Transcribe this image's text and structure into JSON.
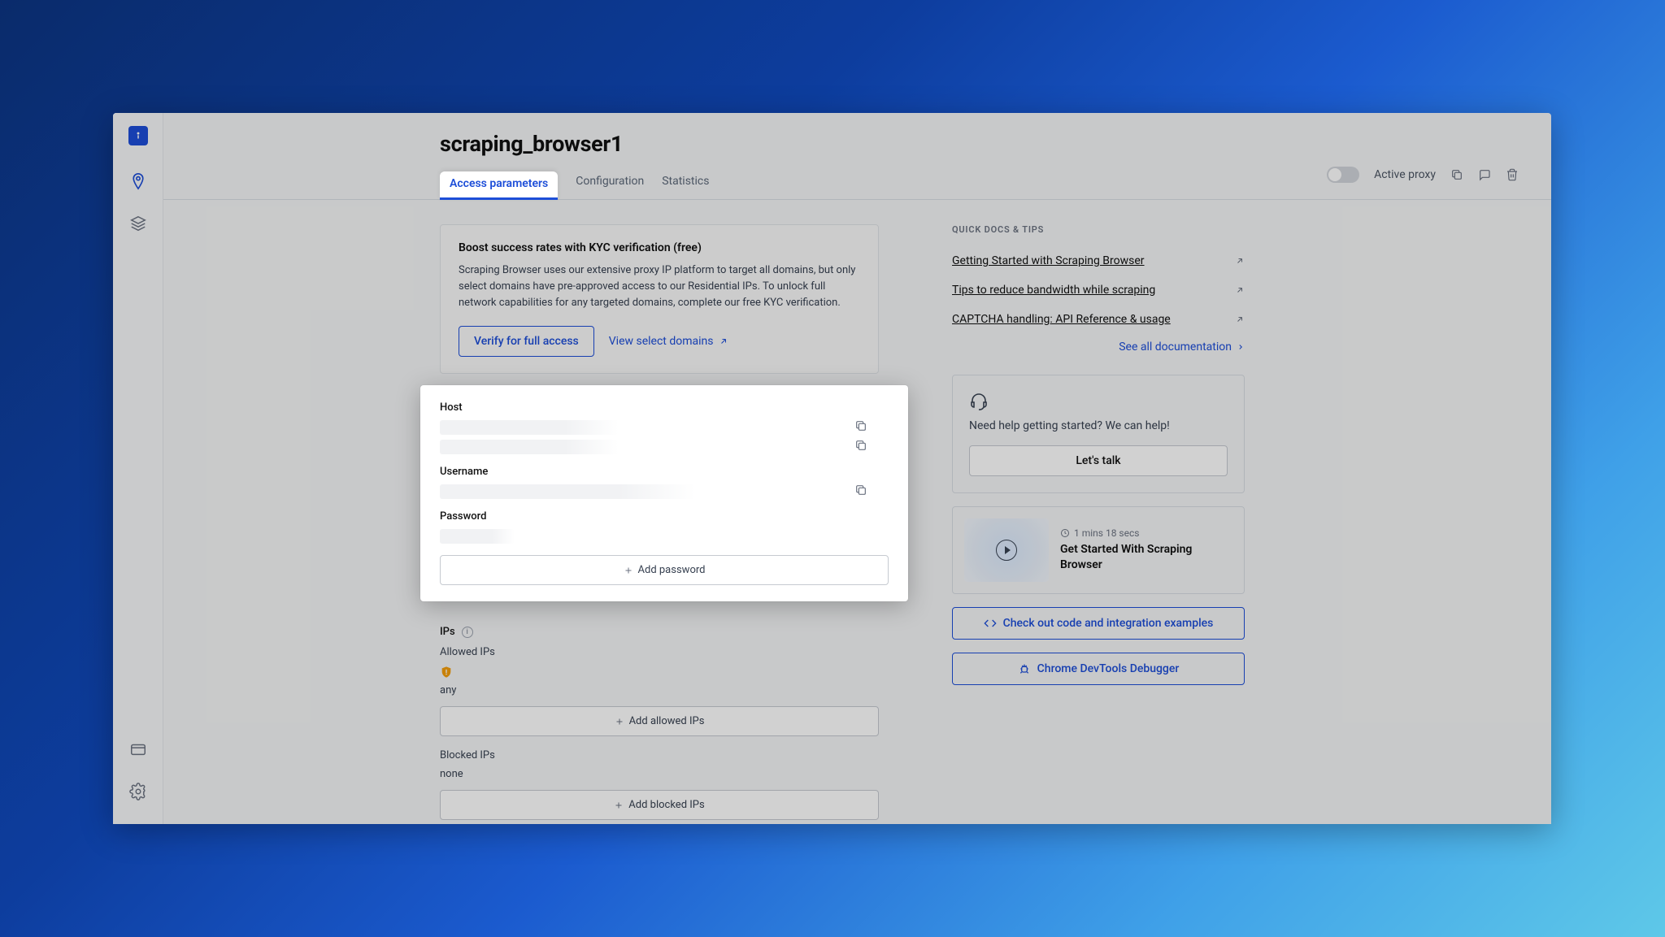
{
  "header": {
    "title": "scraping_browser1",
    "tabs": [
      {
        "label": "Access parameters",
        "active": true
      },
      {
        "label": "Configuration",
        "active": false
      },
      {
        "label": "Statistics",
        "active": false
      }
    ],
    "toggle_label": "Active proxy"
  },
  "kyc": {
    "title": "Boost success rates with KYC verification (free)",
    "body": "Scraping Browser uses our extensive proxy IP platform to target all domains, but only select domains have pre-approved access to our Residential IPs. To unlock full network capabilities for any targeted domains, complete our free KYC verification.",
    "verify_btn": "Verify for full access",
    "view_link": "View select domains"
  },
  "creds": {
    "host_label": "Host",
    "username_label": "Username",
    "password_label": "Password",
    "add_password_btn": "Add password"
  },
  "ips": {
    "section": "IPs",
    "allowed_label": "Allowed IPs",
    "allowed_value": "any",
    "add_allowed_btn": "Add allowed IPs",
    "blocked_label": "Blocked IPs",
    "blocked_value": "none",
    "add_blocked_btn": "Add blocked IPs"
  },
  "docs": {
    "heading": "QUICK DOCS & TIPS",
    "links": [
      "Getting Started with Scraping Browser",
      "Tips to reduce bandwidth while scraping",
      "CAPTCHA handling: API Reference & usage"
    ],
    "see_all": "See all documentation"
  },
  "help": {
    "text": "Need help getting started? We can help!",
    "btn": "Let's talk"
  },
  "video": {
    "duration": "1 mins 18 secs",
    "title": "Get Started With Scraping Browser"
  },
  "buttons": {
    "code_examples": "Check out code and integration examples",
    "devtools": "Chrome DevTools Debugger"
  }
}
